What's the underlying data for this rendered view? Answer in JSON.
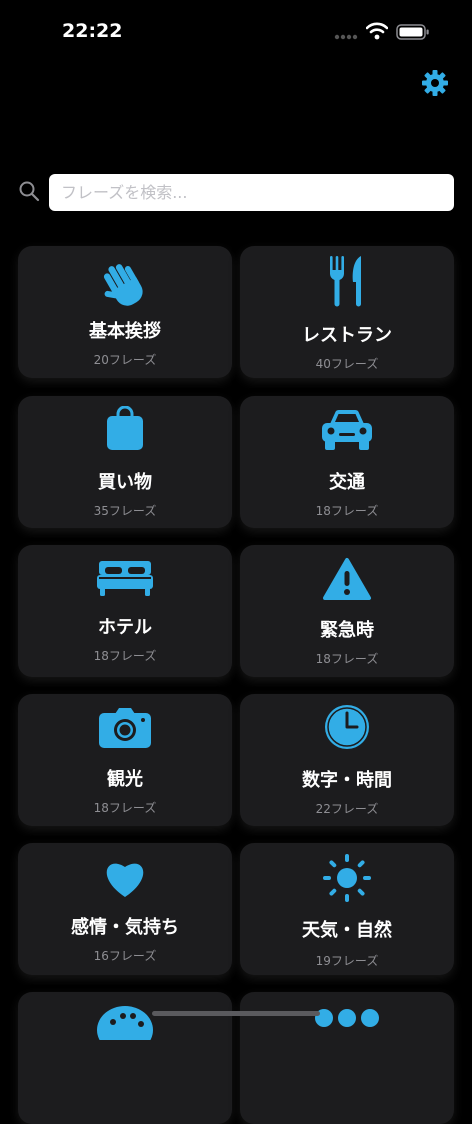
{
  "status": {
    "time": "22:22"
  },
  "search": {
    "placeholder": "フレーズを検索..."
  },
  "accent_color": "#32ADE6",
  "categories": [
    {
      "title": "基本挨拶",
      "count": "20フレーズ",
      "icon": "wave-hand-icon"
    },
    {
      "title": "レストラン",
      "count": "40フレーズ",
      "icon": "fork-knife-icon"
    },
    {
      "title": "買い物",
      "count": "35フレーズ",
      "icon": "shopping-bag-icon"
    },
    {
      "title": "交通",
      "count": "18フレーズ",
      "icon": "car-icon"
    },
    {
      "title": "ホテル",
      "count": "18フレーズ",
      "icon": "bed-icon"
    },
    {
      "title": "緊急時",
      "count": "18フレーズ",
      "icon": "warning-icon"
    },
    {
      "title": "観光",
      "count": "18フレーズ",
      "icon": "camera-icon"
    },
    {
      "title": "数字・時間",
      "count": "22フレーズ",
      "icon": "clock-icon"
    },
    {
      "title": "感情・気持ち",
      "count": "16フレーズ",
      "icon": "heart-icon"
    },
    {
      "title": "天気・自然",
      "count": "19フレーズ",
      "icon": "sun-icon"
    }
  ]
}
